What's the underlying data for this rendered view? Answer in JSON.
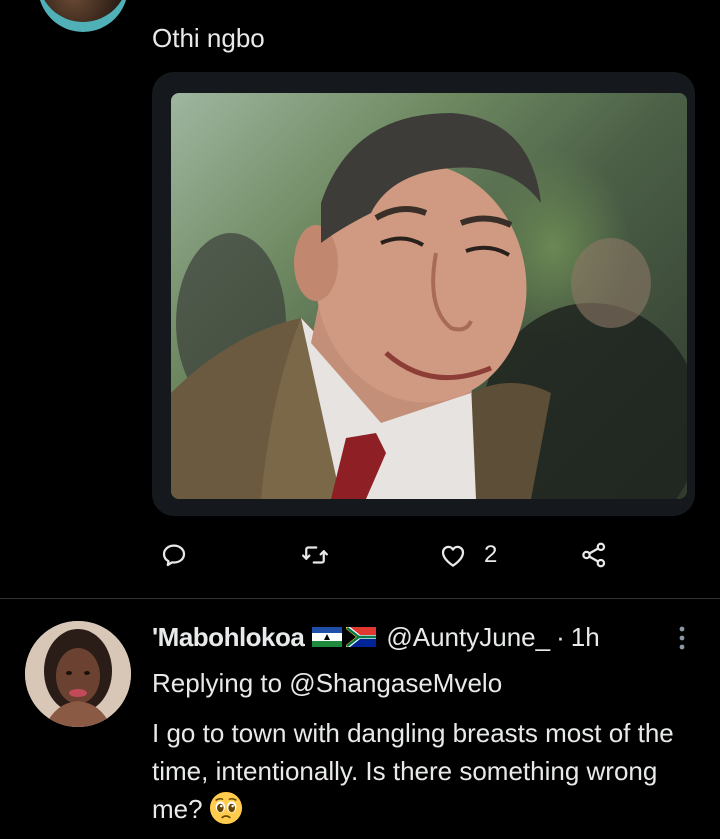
{
  "tweet_top": {
    "text": "Othi ngbo",
    "media_description_icon": "photo",
    "actions": {
      "reply_icon": "reply-icon",
      "retweet_icon": "retweet-icon",
      "like_icon": "heart-icon",
      "like_count": "2",
      "share_icon": "share-icon"
    }
  },
  "tweet_reply": {
    "display_name": "'Mabohlokoa",
    "flags": [
      "lesotho-flag-icon",
      "south-africa-flag-icon"
    ],
    "handle": "@AuntyJune_",
    "separator": "·",
    "timestamp": "1h",
    "replying_to": "Replying to @ShangaseMvelo",
    "body": "I go to town with dangling breasts most of the time, intentionally. Is there something wrong me?",
    "emoji": "pleading-face-icon"
  },
  "colors": {
    "background": "#000000",
    "text": "#e7e9ea",
    "divider": "#2f3336",
    "media_frame": "#15181c"
  }
}
